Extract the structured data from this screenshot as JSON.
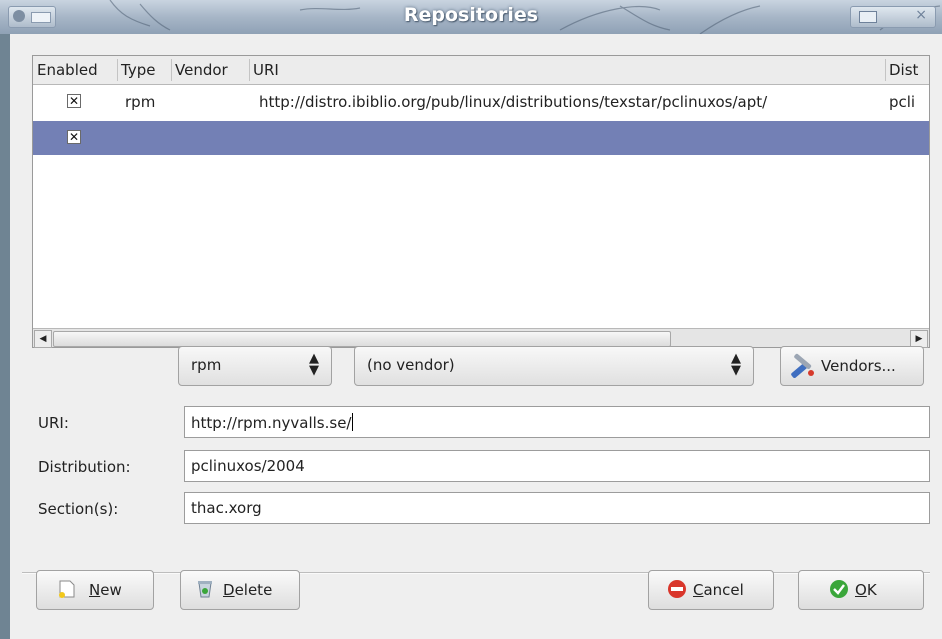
{
  "window": {
    "title": "Repositories"
  },
  "table": {
    "columns": [
      "Enabled",
      "Type",
      "Vendor",
      "URI",
      "Dist"
    ],
    "rows": [
      {
        "enabled": "✕",
        "type": "rpm",
        "vendor": "",
        "uri": "http://distro.ibiblio.org/pub/linux/distributions/texstar/pclinuxos/apt/",
        "dist": "pcli",
        "selected": false
      },
      {
        "enabled": "✕",
        "type": "",
        "vendor": "",
        "uri": "",
        "dist": "",
        "selected": true
      }
    ]
  },
  "editor": {
    "type_value": "rpm",
    "vendor_value": "(no vendor)",
    "vendors_button": "Vendors...",
    "uri_label": "URI:",
    "uri_value": "http://rpm.nyvalls.se/",
    "distribution_label": "Distribution:",
    "distribution_value": "pclinuxos/2004",
    "sections_label": "Section(s):",
    "sections_value": "thac.xorg"
  },
  "buttons": {
    "new_prefix": "",
    "new_mnemonic": "N",
    "new_rest": "ew",
    "delete_mnemonic": "D",
    "delete_rest": "elete",
    "cancel_mnemonic": "C",
    "cancel_rest": "ancel",
    "ok_mnemonic": "O",
    "ok_rest": "K"
  },
  "colors": {
    "selection": "#7380b5",
    "titlebar": "#a7b6c7",
    "cancel_icon": "#d9362b",
    "ok_icon": "#3aa63a"
  }
}
